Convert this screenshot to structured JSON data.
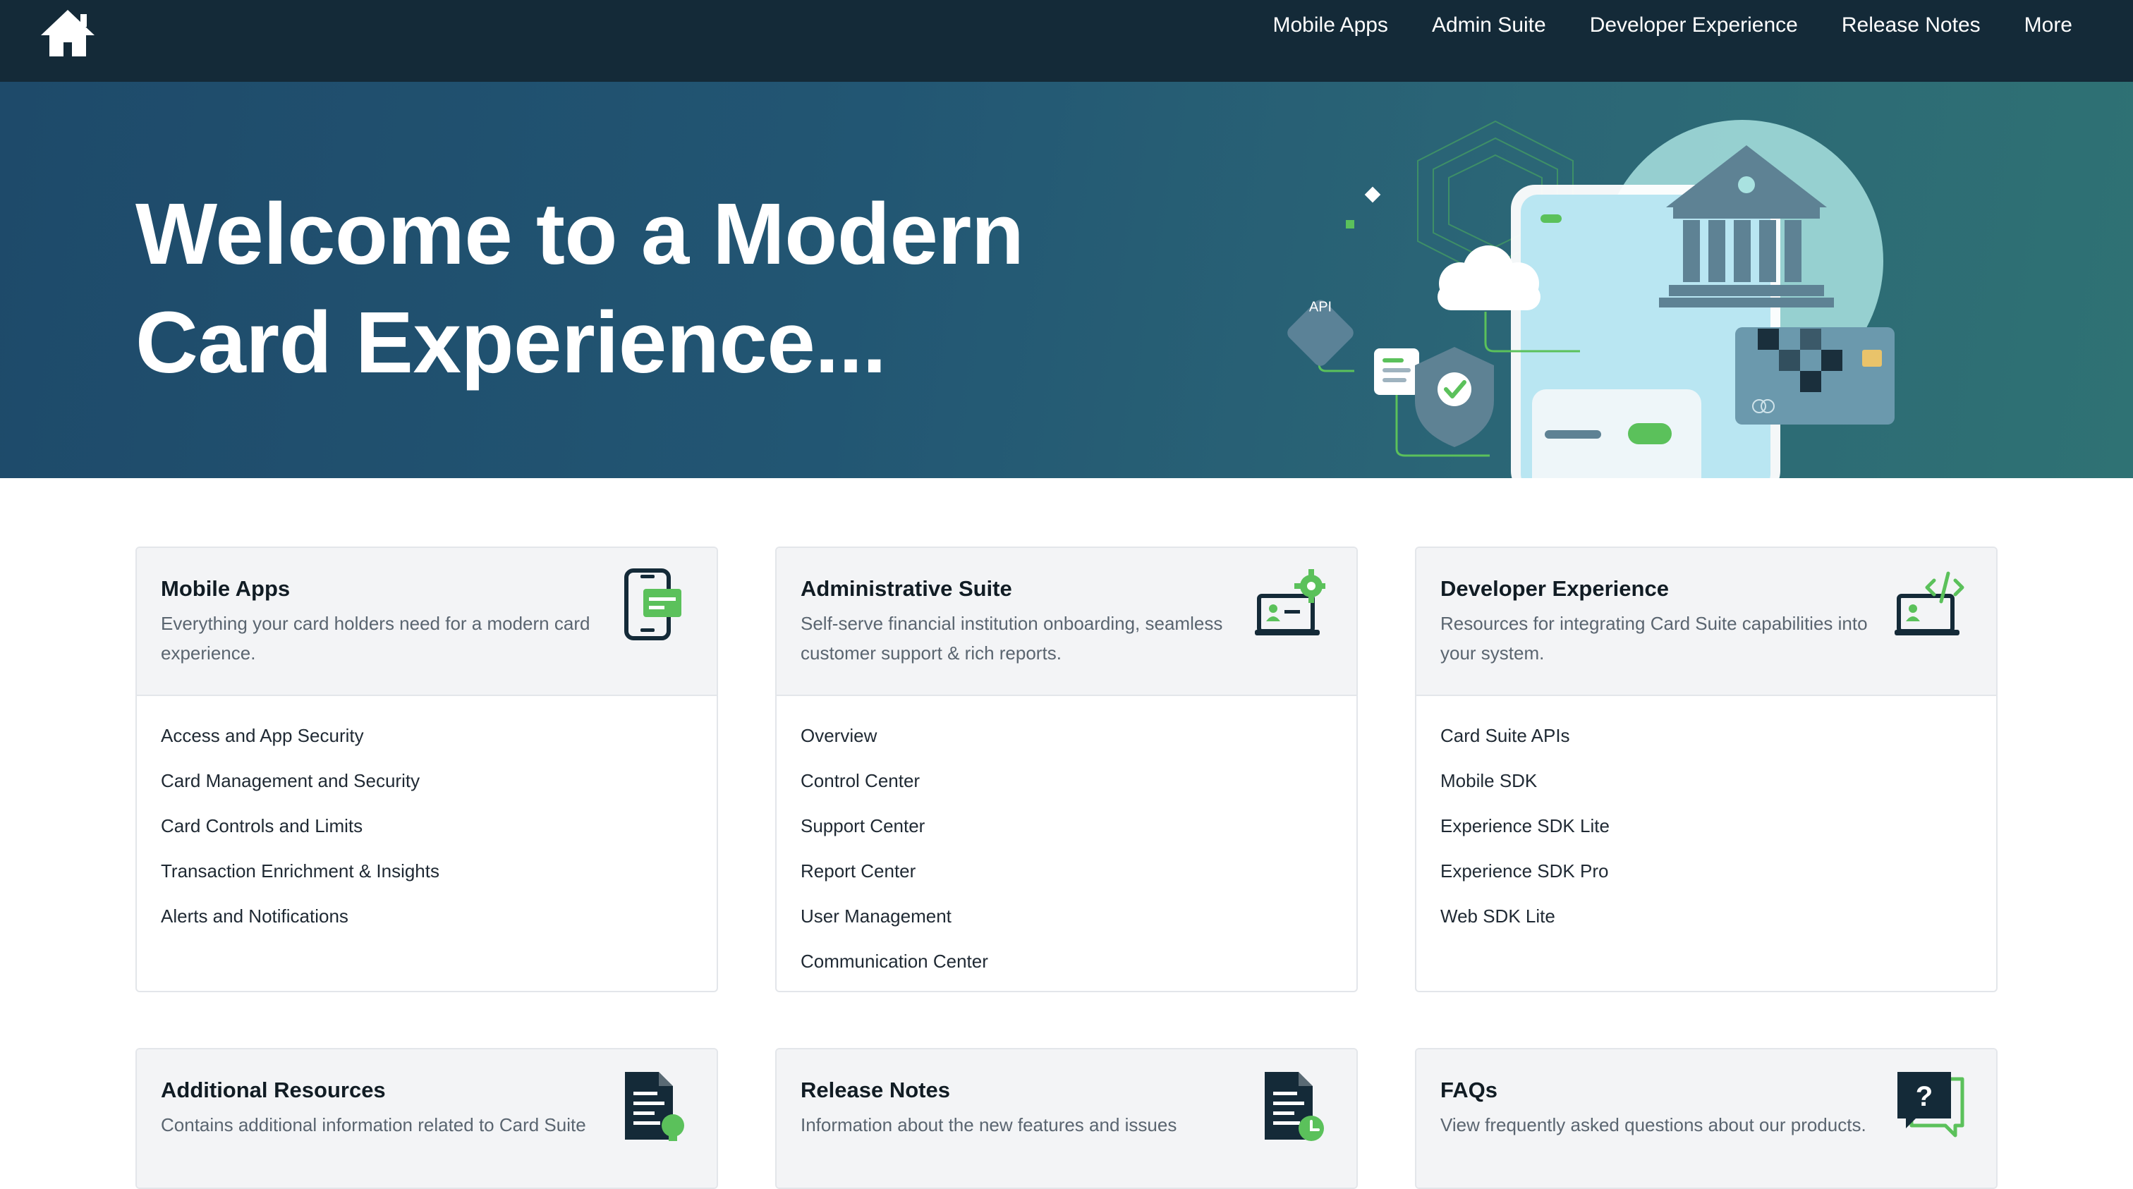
{
  "nav": {
    "home_icon": "home-icon",
    "items": [
      "Mobile Apps",
      "Admin Suite",
      "Developer Experience",
      "Release Notes",
      "More"
    ]
  },
  "hero": {
    "title_line1": "Welcome to a Modern",
    "title_line2": "Card Experience...",
    "api_badge": "API"
  },
  "colors": {
    "nav_bg": "#142a38",
    "hero_bg_start": "#1e4a6a",
    "hero_bg_end": "#2f7274",
    "accent_green": "#5bc15b",
    "icon_dark": "#142a38"
  },
  "cards": [
    {
      "title": "Mobile Apps",
      "description": "Everything your card holders need for a modern card experience.",
      "icon": "mobile-phone-icon",
      "links": [
        "Access and App Security",
        "Card Management and Security",
        "Card Controls and Limits",
        "Transaction Enrichment & Insights",
        "Alerts and Notifications"
      ]
    },
    {
      "title": "Administrative Suite",
      "description": "Self-serve financial institution onboarding, seamless customer support & rich reports.",
      "icon": "laptop-gear-icon",
      "links": [
        "Overview",
        "Control Center",
        "Support Center",
        "Report Center",
        "User Management",
        "Communication Center"
      ]
    },
    {
      "title": "Developer Experience",
      "description": "Resources for integrating Card Suite capabilities into your system.",
      "icon": "laptop-code-icon",
      "links": [
        "Card Suite APIs",
        "Mobile SDK",
        "Experience SDK Lite",
        "Experience SDK Pro",
        "Web SDK Lite"
      ]
    },
    {
      "title": "Additional Resources",
      "description": "Contains additional information related to Card Suite",
      "icon": "document-lightbulb-icon"
    },
    {
      "title": "Release Notes",
      "description": "Information about the new features and issues",
      "icon": "document-clock-icon"
    },
    {
      "title": "FAQs",
      "description": "View frequently asked questions about our products.",
      "icon": "question-chat-icon"
    }
  ]
}
